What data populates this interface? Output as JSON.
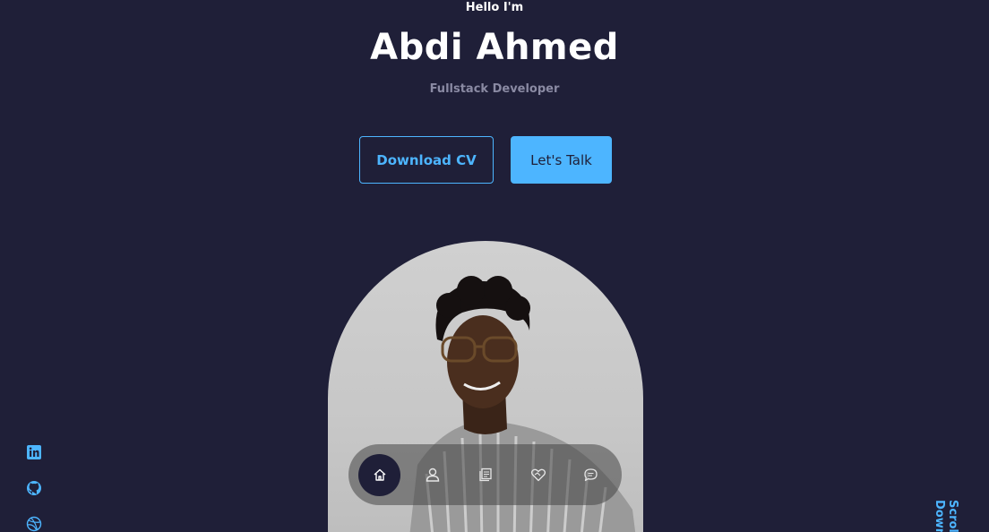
{
  "hero": {
    "greeting": "Hello I'm",
    "name": "Abdi Ahmed",
    "role": "Fullstack Developer"
  },
  "buttons": {
    "download_cv": "Download CV",
    "lets_talk": "Let's Talk"
  },
  "nav": {
    "items": [
      {
        "icon": "home-icon",
        "active": true
      },
      {
        "icon": "user-icon",
        "active": false
      },
      {
        "icon": "book-icon",
        "active": false
      },
      {
        "icon": "services-icon",
        "active": false
      },
      {
        "icon": "message-icon",
        "active": false
      }
    ]
  },
  "socials": [
    {
      "icon": "linkedin-icon"
    },
    {
      "icon": "github-icon"
    },
    {
      "icon": "dribbble-icon"
    }
  ],
  "scroll": {
    "label": "Scroll Down"
  },
  "colors": {
    "background": "#1f1f38",
    "primary": "#4db5ff",
    "muted": "#8a8aa3"
  }
}
